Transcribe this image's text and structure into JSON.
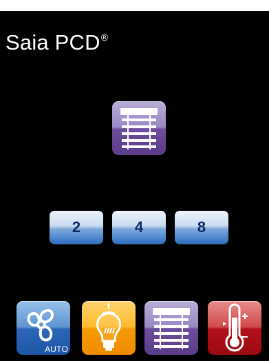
{
  "brand": {
    "name": "Saia PCD",
    "mark": "®"
  },
  "blinds_tile": {
    "icon": "blinds-icon",
    "color": "#6d4e9b"
  },
  "number_buttons": [
    "2",
    "4",
    "8"
  ],
  "bottom_bar": {
    "fan": {
      "icon": "fan-icon",
      "badge": "AUTO",
      "color": "#2c66b7"
    },
    "light": {
      "icon": "bulb-icon",
      "color": "#f79a00"
    },
    "blinds": {
      "icon": "blinds-icon",
      "color": "#6d4e9b"
    },
    "thermostat": {
      "icon": "thermometer-icon",
      "color": "#b3101a"
    }
  }
}
